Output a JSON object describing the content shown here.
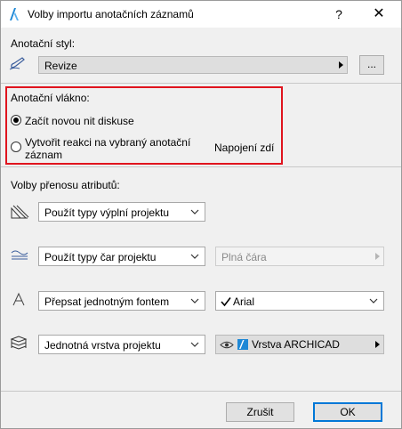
{
  "window": {
    "title": "Volby importu anotačních záznamů",
    "help_glyph": "?",
    "close_glyph": "✕"
  },
  "markup_style": {
    "label": "Anotační styl:",
    "value": "Revize",
    "browse_label": "..."
  },
  "markup_thread": {
    "label": "Anotační vlákno:",
    "option_new": "Začít novou nit diskuse",
    "option_reply_line1": "Vytvořit reakci na vybraný anotační",
    "option_reply_line2": "záznam",
    "reply_target": "Napojení zdí",
    "selected": "new"
  },
  "attributes": {
    "label": "Volby přenosu atributů:",
    "fill_type": "Použít typy výplní projektu",
    "line_type": "Použít typy čar projektu",
    "line_type_secondary": "Plná čára",
    "font_mode": "Přepsat jednotným fontem",
    "font_name": "Arial",
    "layer_mode": "Jednotná vrstva projektu",
    "layer_name": "Vrstva ARCHICAD"
  },
  "footer": {
    "cancel_label": "Zrušit",
    "ok_label": "OK"
  }
}
